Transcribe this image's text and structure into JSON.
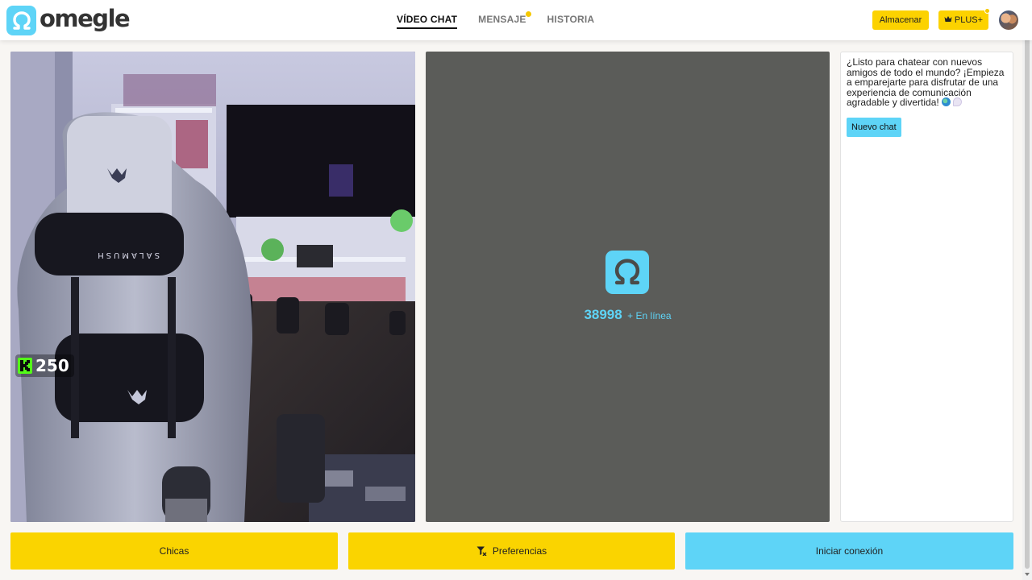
{
  "brand": {
    "name": "omegle",
    "accent": "#5ed4f7",
    "yellow": "#fad400"
  },
  "nav": [
    {
      "label": "VÍDEO CHAT",
      "active": true,
      "dot": false
    },
    {
      "label": "MENSAJE",
      "active": false,
      "dot": true
    },
    {
      "label": "HISTORIA",
      "active": false,
      "dot": false
    }
  ],
  "header": {
    "store_label": "Almacenar",
    "plus_label": "PLUS+",
    "plus_icon": "crown-icon"
  },
  "camera": {
    "kick_count": "250",
    "kick_icon": "kick-logo-icon"
  },
  "partner": {
    "online_count": "38998",
    "online_label": "+ En línea"
  },
  "chat": {
    "message": "¿Listo para chatear con nuevos amigos de todo el mundo? ¡Empieza a emparejarte para disfrutar de una experiencia de comunicación agradable y divertida!",
    "new_chat_label": "Nuevo chat"
  },
  "bottom": {
    "girls_label": "Chicas",
    "preferences_label": "Preferencias",
    "preferences_icon": "filter-icon",
    "start_label": "Iniciar conexión"
  }
}
